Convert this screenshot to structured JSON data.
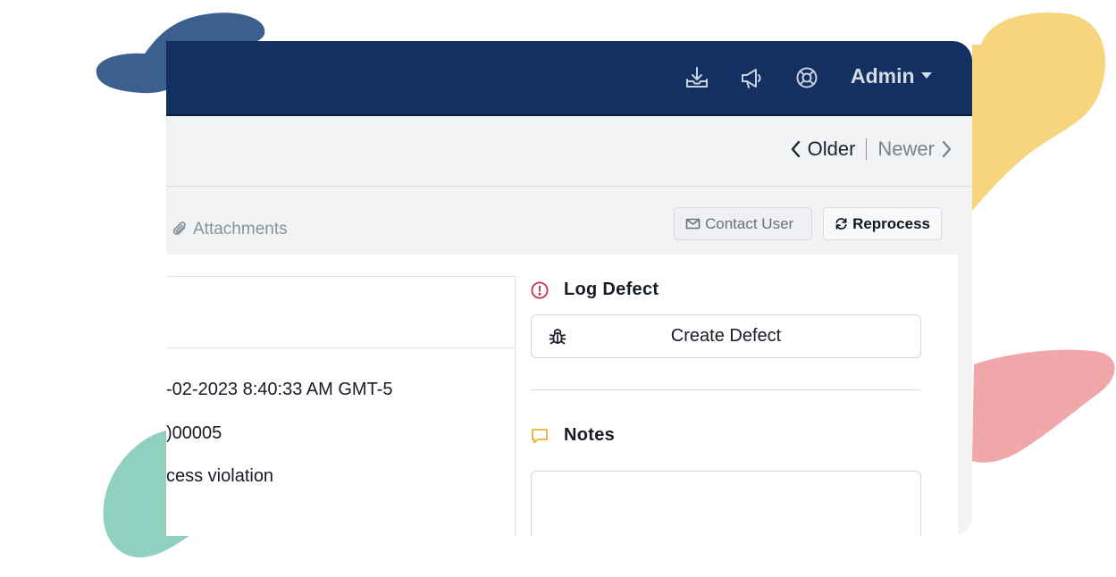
{
  "header": {
    "icons": [
      "download-tray-icon",
      "megaphone-icon",
      "lifebuoy-icon"
    ],
    "user_menu_label": "Admin",
    "background_color": "#133061"
  },
  "pager": {
    "older_label": "Older",
    "newer_label": "Newer"
  },
  "tabs": {
    "attachments_label": "Attachments"
  },
  "actions": {
    "contact_user_label": "Contact User",
    "reprocess_label": "Reprocess"
  },
  "details": {
    "timestamp": "-02-2023 8:40:33 AM GMT-5",
    "code": ")00005",
    "error_text": "cess violation"
  },
  "log_defect": {
    "title": "Log Defect",
    "create_button_label": "Create Defect",
    "accent_color": "#c0304a"
  },
  "notes": {
    "title": "Notes",
    "placeholder": "",
    "accent_color": "#e8b22e"
  }
}
